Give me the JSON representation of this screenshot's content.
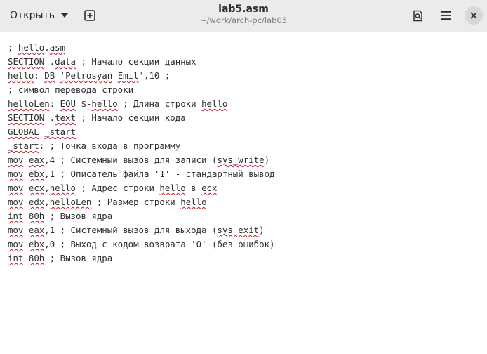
{
  "header": {
    "open_label": "Открыть",
    "title": "lab5.asm",
    "subtitle": "~/work/arch-pc/lab05",
    "icons": [
      "new-tab-icon",
      "search-icon",
      "menu-icon",
      "close-icon"
    ]
  },
  "editor": {
    "lines": [
      [
        {
          "t": "; "
        },
        {
          "t": "hello",
          "s": 1
        },
        {
          "t": "."
        },
        {
          "t": "asm",
          "s": 1
        }
      ],
      [
        {
          "t": "SECTION",
          "s": 1
        },
        {
          "t": " ."
        },
        {
          "t": "data",
          "s": 1
        },
        {
          "t": " ; Начало секции данных"
        }
      ],
      [
        {
          "t": "hello",
          "s": 1
        },
        {
          "t": ": "
        },
        {
          "t": "DB",
          "s": 1
        },
        {
          "t": " "
        },
        {
          "t": "'Petrosyan",
          "s": 1
        },
        {
          "t": " "
        },
        {
          "t": "Emil",
          "s": 1
        },
        {
          "t": "',10 ;"
        }
      ],
      [
        {
          "t": "; символ перевода строки"
        }
      ],
      [
        {
          "t": "helloLen",
          "s": 1
        },
        {
          "t": ": "
        },
        {
          "t": "EQU",
          "s": 1
        },
        {
          "t": " $-"
        },
        {
          "t": "hello",
          "s": 1
        },
        {
          "t": " ; Длина строки "
        },
        {
          "t": "hello",
          "s": 1
        }
      ],
      [
        {
          "t": "SECTION",
          "s": 1
        },
        {
          "t": " ."
        },
        {
          "t": "text",
          "s": 1
        },
        {
          "t": " ; Начало секции кода"
        }
      ],
      [
        {
          "t": "GLOBAL",
          "s": 1
        },
        {
          "t": " "
        },
        {
          "t": "_start",
          "s": 1
        }
      ],
      [
        {
          "t": "_start",
          "s": 1
        },
        {
          "t": ": ; Точка входа в программу"
        }
      ],
      [
        {
          "t": "mov",
          "s": 1
        },
        {
          "t": " "
        },
        {
          "t": "eax",
          "s": 1
        },
        {
          "t": ",4 ; Системный вызов для записи ("
        },
        {
          "t": "sys_write",
          "s": 1
        },
        {
          "t": ")"
        }
      ],
      [
        {
          "t": "mov",
          "s": 1
        },
        {
          "t": " "
        },
        {
          "t": "ebx",
          "s": 1
        },
        {
          "t": ",1 ; Описатель файла '1' - стандартный вывод"
        }
      ],
      [
        {
          "t": "mov",
          "s": 1
        },
        {
          "t": " "
        },
        {
          "t": "ecx",
          "s": 1
        },
        {
          "t": ","
        },
        {
          "t": "hello",
          "s": 1
        },
        {
          "t": " ; Адрес строки "
        },
        {
          "t": "hello",
          "s": 1
        },
        {
          "t": " в "
        },
        {
          "t": "ecx",
          "s": 1
        }
      ],
      [
        {
          "t": "mov",
          "s": 1
        },
        {
          "t": " "
        },
        {
          "t": "edx",
          "s": 1
        },
        {
          "t": ","
        },
        {
          "t": "helloLen",
          "s": 1
        },
        {
          "t": " ; Размер строки "
        },
        {
          "t": "hello",
          "s": 1
        }
      ],
      [
        {
          "t": "int",
          "s": 1
        },
        {
          "t": " "
        },
        {
          "t": "80h",
          "s": 1
        },
        {
          "t": " ; Вызов ядра"
        }
      ],
      [
        {
          "t": "mov",
          "s": 1
        },
        {
          "t": " "
        },
        {
          "t": "eax",
          "s": 1
        },
        {
          "t": ",1 ; Системный вызов для выхода ("
        },
        {
          "t": "sys_exit",
          "s": 1
        },
        {
          "t": ")"
        }
      ],
      [
        {
          "t": "mov",
          "s": 1
        },
        {
          "t": " "
        },
        {
          "t": "ebx",
          "s": 1
        },
        {
          "t": ",0 ; Выход с кодом возврата '0' (без ошибок)"
        }
      ],
      [
        {
          "t": "int",
          "s": 1
        },
        {
          "t": " "
        },
        {
          "t": "80h",
          "s": 1
        },
        {
          "t": " ; Вызов ядра"
        }
      ]
    ]
  },
  "colors": {
    "header_bg": "#ebebeb",
    "text": "#2e2e2e",
    "spell_underline": "#c01c28"
  }
}
